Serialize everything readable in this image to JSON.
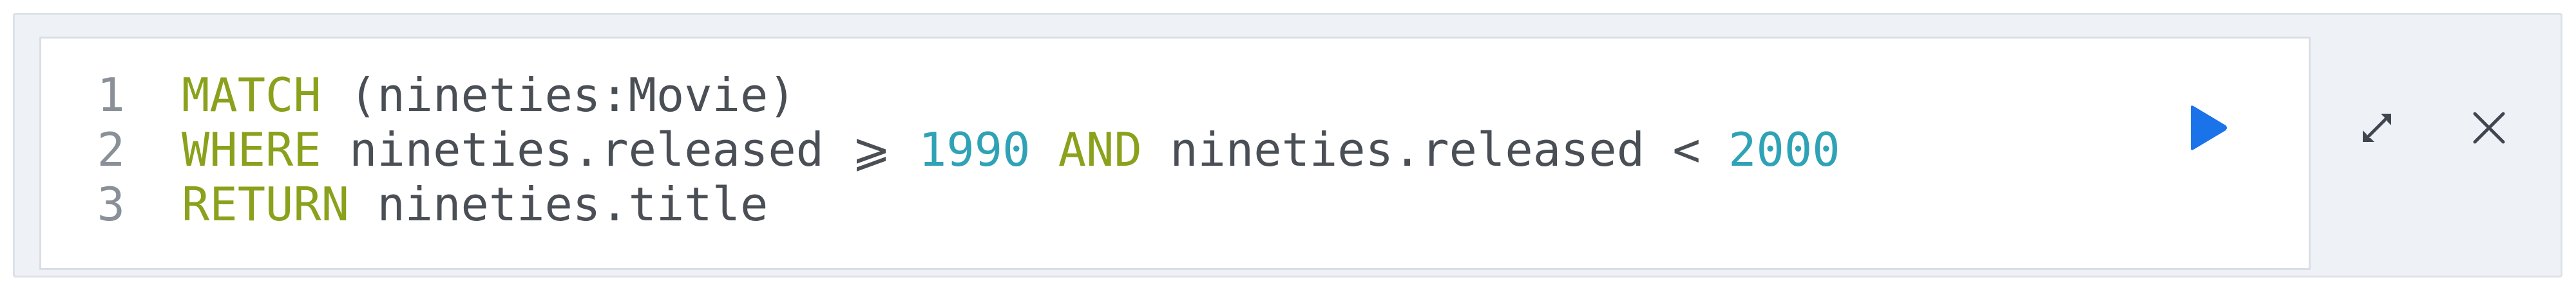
{
  "editor": {
    "lines": [
      {
        "number": "1",
        "tokens": [
          {
            "text": "MATCH",
            "type": "keyword"
          },
          {
            "text": " (nineties:Movie)",
            "type": "text"
          }
        ]
      },
      {
        "number": "2",
        "tokens": [
          {
            "text": "WHERE",
            "type": "keyword"
          },
          {
            "text": " nineties.released ",
            "type": "text"
          },
          {
            "text": "⩾",
            "type": "text"
          },
          {
            "text": " ",
            "type": "text"
          },
          {
            "text": "1990",
            "type": "number"
          },
          {
            "text": " ",
            "type": "text"
          },
          {
            "text": "AND",
            "type": "keyword"
          },
          {
            "text": " nineties.released < ",
            "type": "text"
          },
          {
            "text": "2000",
            "type": "number"
          }
        ]
      },
      {
        "number": "3",
        "tokens": [
          {
            "text": "RETURN",
            "type": "keyword"
          },
          {
            "text": " nineties.title",
            "type": "text"
          }
        ]
      }
    ]
  },
  "actions": {
    "run_icon": "play-icon",
    "expand_icon": "expand-icon",
    "close_icon": "close-icon"
  },
  "colors": {
    "keyword": "#8aa11c",
    "number": "#2fa3b5",
    "text": "#4a4f55",
    "gutter": "#8a9098",
    "accent": "#1a73e8"
  }
}
